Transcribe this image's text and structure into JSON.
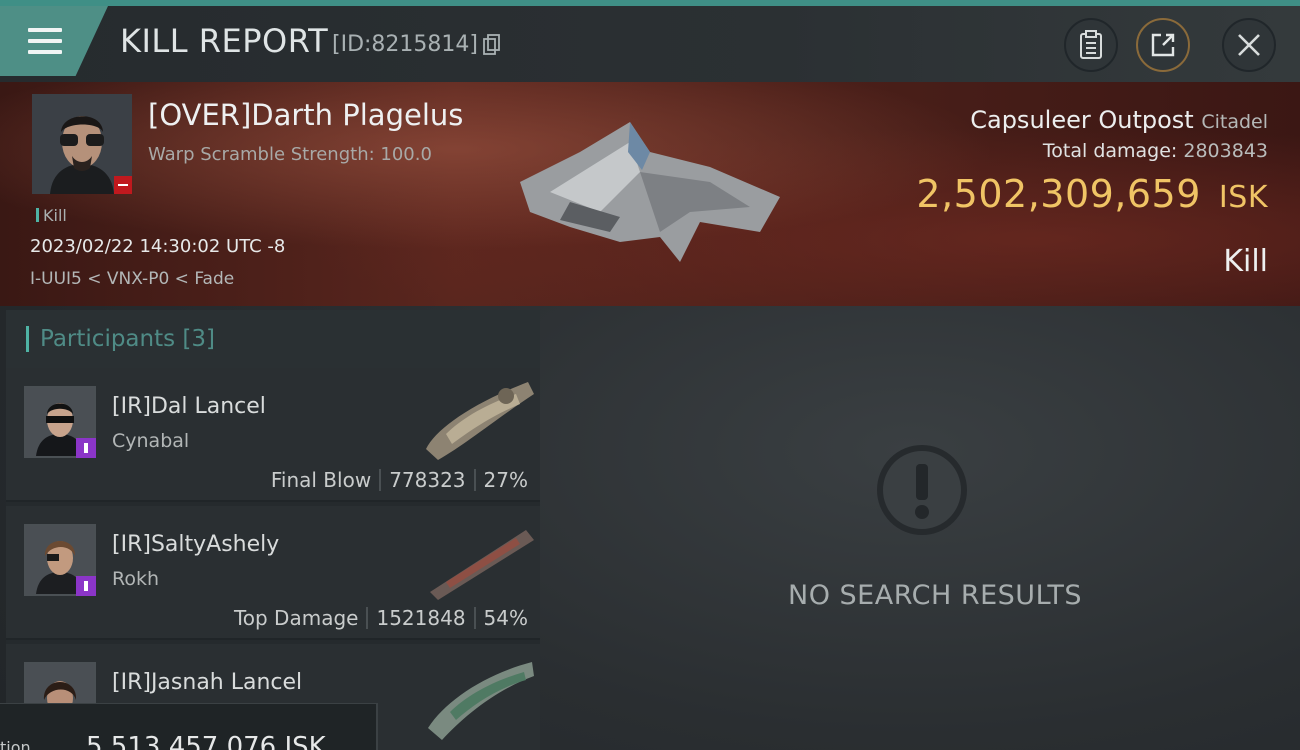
{
  "header": {
    "title": "KILL REPORT",
    "report_id": "[ID:8215814]"
  },
  "victim": {
    "name": "[OVER]Darth Plagelus",
    "subtitle": "Warp Scramble Strength: 100.0",
    "tag": "Kill",
    "datetime": "2023/02/22 14:30:02 UTC -8",
    "location": "I-UUI5 < VNX-P0 < Fade"
  },
  "summary": {
    "structure_name": "Capsuleer Outpost",
    "structure_class": "Citadel",
    "total_damage_label": "Total damage:",
    "total_damage_value": "2803843",
    "isk_value": "2,502,309,659",
    "isk_unit": "ISK",
    "result": "Kill"
  },
  "participants": {
    "label": "Participants",
    "count": "[3]",
    "rows": [
      {
        "name": "[IR]Dal Lancel",
        "ship": "Cynabal",
        "role": "Final Blow",
        "damage": "778323",
        "percent": "27%"
      },
      {
        "name": "[IR]SaltyAshely",
        "ship": "Rokh",
        "role": "Top Damage",
        "damage": "1521848",
        "percent": "54%"
      },
      {
        "name": "[IR]Jasnah Lancel",
        "ship": "",
        "role": "",
        "damage": "",
        "percent": ""
      }
    ]
  },
  "empty_state": {
    "text": "NO SEARCH RESULTS"
  },
  "bottom_popup": {
    "label": "tion",
    "value": "5,513,457,076 ISK"
  },
  "colors": {
    "accent": "#4e8f86",
    "isk": "#f0c465",
    "badge": "#8b35c8",
    "warning": "#c0191e"
  }
}
